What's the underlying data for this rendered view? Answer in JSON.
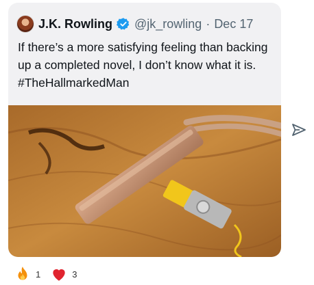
{
  "tweet": {
    "author_name": "J.K. Rowling",
    "handle": "@jk_rowling",
    "separator": "·",
    "date": "Dec 17",
    "text": "If there’s a more satisfying feeling than backing up a completed novel, I don’t know what it is. #TheHallmarkedMan"
  },
  "reactions": [
    {
      "icon": "fire-icon",
      "count": "1"
    },
    {
      "icon": "heart-icon",
      "count": "3"
    }
  ],
  "colors": {
    "card_bg": "#f1f1f3",
    "verified": "#1d9bf0",
    "text_secondary": "#536471",
    "heart": "#e0242f",
    "hub": "#c2916f",
    "usb": "#f1c61b"
  }
}
